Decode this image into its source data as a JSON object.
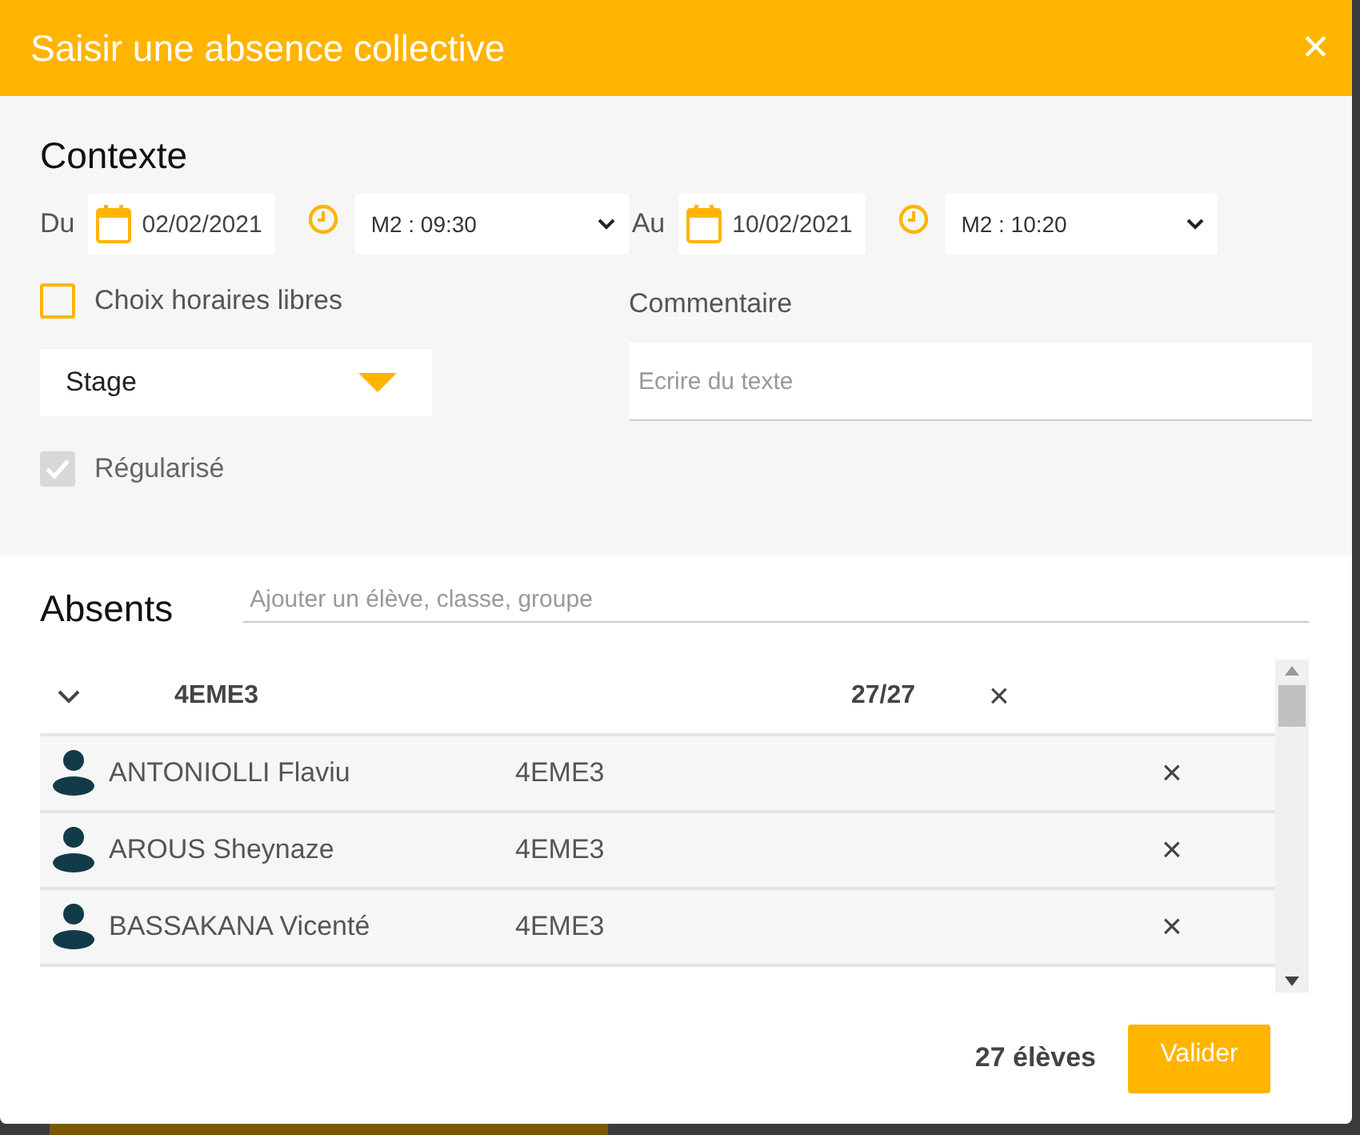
{
  "dialog": {
    "title": "Saisir une absence collective",
    "close": "✕"
  },
  "context": {
    "heading": "Contexte",
    "from": {
      "label": "Du",
      "date": "02/02/2021",
      "time": "M2 : 09:30"
    },
    "to": {
      "label": "Au",
      "date": "10/02/2021",
      "time": "M2 : 10:20"
    },
    "free_hours": {
      "label": "Choix horaires libres",
      "checked": false
    },
    "reason": {
      "value": "Stage"
    },
    "regularized": {
      "label": "Régularisé",
      "checked": true,
      "disabled": true
    },
    "comment": {
      "label": "Commentaire",
      "placeholder": "Ecrire du texte"
    }
  },
  "absents": {
    "heading": "Absents",
    "search": {
      "placeholder": "Ajouter un élève, classe, groupe"
    },
    "group": {
      "name": "4EME3",
      "count": "27/27",
      "expanded": true,
      "remove": "×"
    },
    "students": [
      {
        "name": "ANTONIOLLI Flaviu",
        "class": "4EME3",
        "remove": "×"
      },
      {
        "name": "AROUS Sheynaze",
        "class": "4EME3",
        "remove": "×"
      },
      {
        "name": "BASSAKANA Vicenté",
        "class": "4EME3",
        "remove": "×"
      }
    ]
  },
  "footer": {
    "total": "27 élèves",
    "submit": "Valider"
  }
}
